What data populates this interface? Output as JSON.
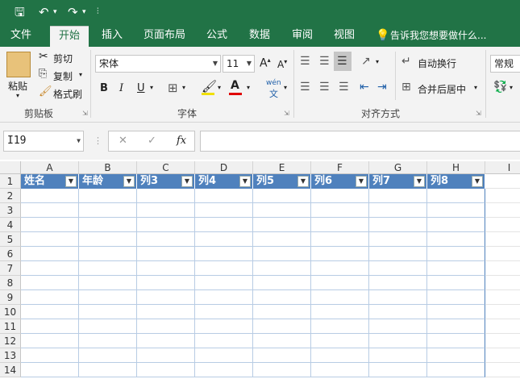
{
  "quick_access": {
    "save_icon": "save-icon",
    "undo_icon": "undo-icon",
    "redo_icon": "redo-icon",
    "customize_icon": "customize-icon"
  },
  "tabs": [
    "文件",
    "开始",
    "插入",
    "页面布局",
    "公式",
    "数据",
    "审阅",
    "视图"
  ],
  "tell_me": "告诉我您想要做什么...",
  "clipboard": {
    "paste": "粘贴",
    "cut": "剪切",
    "copy": "复制",
    "format_painter": "格式刷",
    "group": "剪贴板"
  },
  "font": {
    "name": "宋体",
    "size": "11",
    "bold": "B",
    "italic": "I",
    "underline": "U",
    "group": "字体",
    "wen": "wén",
    "wen2": "文",
    "color_a": "A"
  },
  "alignment": {
    "wrap": "自动换行",
    "merge": "合并后居中",
    "group": "对齐方式"
  },
  "number": {
    "format": "常规"
  },
  "formula_bar": {
    "name_box": "I19",
    "cancel": "✕",
    "enter": "✓",
    "fx": "fx",
    "value": ""
  },
  "columns": [
    "A",
    "B",
    "C",
    "D",
    "E",
    "F",
    "G",
    "H",
    "I"
  ],
  "rows": [
    "1",
    "2",
    "3",
    "4",
    "5",
    "6",
    "7",
    "8",
    "9",
    "10",
    "11",
    "12",
    "13",
    "14"
  ],
  "table_headers": [
    "姓名",
    "年龄",
    "列3",
    "列4",
    "列5",
    "列6",
    "列7",
    "列8"
  ],
  "colors": {
    "accent": "#217346",
    "table_header": "#4f81bd",
    "table_border": "#b8cce4"
  }
}
